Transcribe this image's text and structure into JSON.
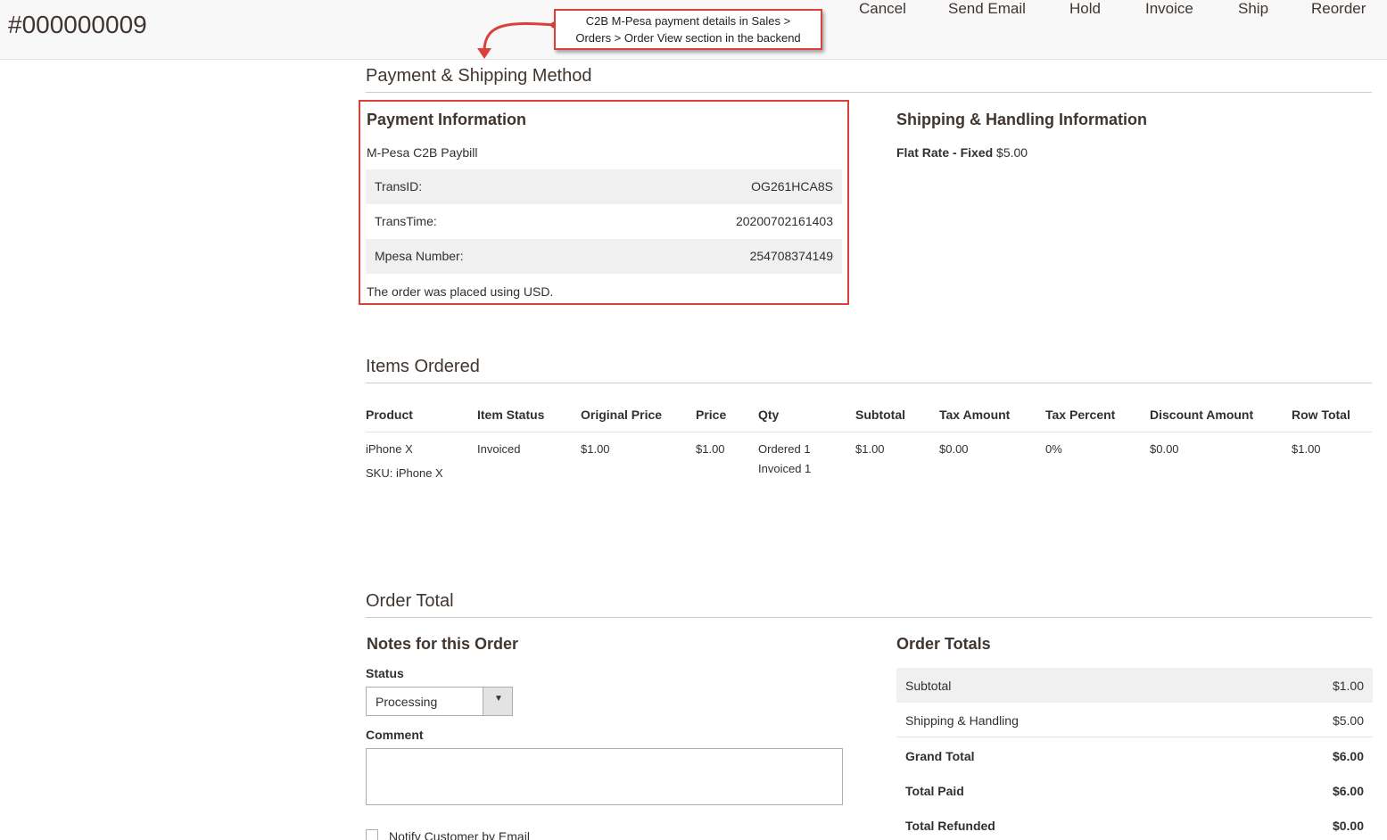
{
  "header": {
    "order_number": "#000000009",
    "actions": [
      "Cancel",
      "Send Email",
      "Hold",
      "Invoice",
      "Ship",
      "Reorder"
    ]
  },
  "annotation": {
    "line1": "C2B M-Pesa payment details in Sales >",
    "line2": "Orders > Order View section in the backend",
    "border_color": "#d9413b"
  },
  "payment_shipping": {
    "section_title": "Payment & Shipping Method",
    "payment": {
      "title": "Payment Information",
      "method": "M-Pesa C2B Paybill",
      "rows": [
        {
          "label": "TransID:",
          "value": "OG261HCA8S"
        },
        {
          "label": "TransTime:",
          "value": "20200702161403"
        },
        {
          "label": "Mpesa Number:",
          "value": "254708374149"
        }
      ],
      "currency_note": "The order was placed using USD."
    },
    "shipping": {
      "title": "Shipping & Handling Information",
      "method_label": "Flat Rate - Fixed",
      "method_price": "$5.00"
    }
  },
  "items": {
    "section_title": "Items Ordered",
    "columns": [
      "Product",
      "Item Status",
      "Original Price",
      "Price",
      "Qty",
      "Subtotal",
      "Tax Amount",
      "Tax Percent",
      "Discount Amount",
      "Row Total"
    ],
    "rows": [
      {
        "product": "iPhone X",
        "sku": "SKU: iPhone X",
        "status": "Invoiced",
        "original_price": "$1.00",
        "price": "$1.00",
        "qty_ordered_label": "Ordered",
        "qty_ordered": "1",
        "qty_invoiced_label": "Invoiced",
        "qty_invoiced": "1",
        "subtotal": "$1.00",
        "tax_amount": "$0.00",
        "tax_percent": "0%",
        "discount": "$0.00",
        "row_total": "$1.00"
      }
    ]
  },
  "order_total": {
    "section_title": "Order Total",
    "notes": {
      "title": "Notes for this Order",
      "status_label": "Status",
      "status_value": "Processing",
      "comment_label": "Comment",
      "comment_value": "",
      "notify_label": "Notify Customer by Email"
    },
    "totals": {
      "title": "Order Totals",
      "rows": [
        {
          "label": "Subtotal",
          "value": "$1.00"
        },
        {
          "label": "Shipping & Handling",
          "value": "$5.00"
        },
        {
          "label": "Grand Total",
          "value": "$6.00"
        },
        {
          "label": "Total Paid",
          "value": "$6.00"
        },
        {
          "label": "Total Refunded",
          "value": "$0.00"
        }
      ]
    }
  }
}
